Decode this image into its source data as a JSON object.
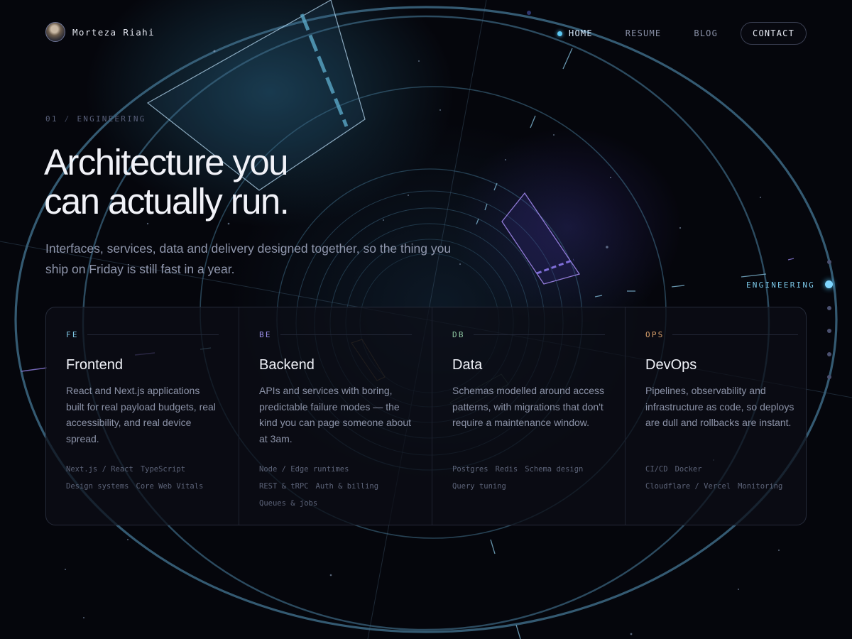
{
  "brand": {
    "name": "Morteza Riahi"
  },
  "nav": {
    "items": [
      {
        "label": "HOME",
        "active": true
      },
      {
        "label": "RESUME",
        "active": false
      },
      {
        "label": "BLOG",
        "active": false
      }
    ],
    "contact_label": "CONTACT"
  },
  "hero": {
    "eyebrow_number": "01",
    "eyebrow_separator": "/",
    "eyebrow_label": "ENGINEERING",
    "headline_line1": "Architecture you",
    "headline_line2": "can actually run.",
    "subtitle": "Interfaces, services, data and delivery designed together, so the thing you ship on Friday is still fast in a year."
  },
  "section_indicator": {
    "label": "ENGINEERING",
    "dot_count": 6,
    "active_index": 1
  },
  "cards": [
    {
      "tag": "FE",
      "tag_color": "#7fc8e6",
      "title": "Frontend",
      "description": "React and Next.js applications built for real payload budgets, real accessibility, and real device spread.",
      "chips": [
        "Next.js / React",
        "TypeScript",
        "Design systems",
        "Core Web Vitals"
      ]
    },
    {
      "tag": "BE",
      "tag_color": "#9a8ee6",
      "title": "Backend",
      "description": "APIs and services with boring, predictable failure modes — the kind you can page someone about at 3am.",
      "chips": [
        "Node / Edge runtimes",
        "REST & tRPC",
        "Auth & billing",
        "Queues & jobs"
      ]
    },
    {
      "tag": "DB",
      "tag_color": "#8fc7a2",
      "title": "Data",
      "description": "Schemas modelled around access patterns, with migrations that don't require a maintenance window.",
      "chips": [
        "Postgres",
        "Redis",
        "Schema design",
        "Query tuning"
      ]
    },
    {
      "tag": "OPS",
      "tag_color": "#d9a06b",
      "title": "DevOps",
      "description": "Pipelines, observability and infrastructure as code, so deploys are dull and rollbacks are instant.",
      "chips": [
        "CI/CD",
        "Docker",
        "Cloudflare / Vercel",
        "Monitoring"
      ]
    }
  ],
  "colors": {
    "background": "#05060c",
    "accent": "#5cc9f5",
    "ring": "#3d6a85"
  }
}
